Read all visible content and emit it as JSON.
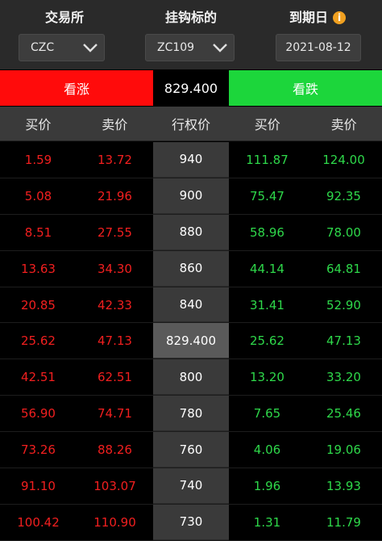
{
  "filters": {
    "exchange": {
      "title": "交易所",
      "value": "CZC"
    },
    "underlying": {
      "title": "挂钩标的",
      "value": "ZC109"
    },
    "expiry": {
      "title": "到期日",
      "value": "2021-08-12",
      "info_icon": "i"
    }
  },
  "strip": {
    "rise_label": "看涨",
    "current_price": "829.400",
    "fall_label": "看跌",
    "colors": {
      "rise": "#ff0b0b",
      "fall": "#1cd63b"
    }
  },
  "table": {
    "headers": [
      "买价",
      "卖价",
      "行权价",
      "买价",
      "卖价"
    ],
    "rows": [
      {
        "call_bid": "1.59",
        "call_ask": "13.72",
        "strike": "940",
        "put_bid": "111.87",
        "put_ask": "124.00"
      },
      {
        "call_bid": "5.08",
        "call_ask": "21.96",
        "strike": "900",
        "put_bid": "75.47",
        "put_ask": "92.35"
      },
      {
        "call_bid": "8.51",
        "call_ask": "27.55",
        "strike": "880",
        "put_bid": "58.96",
        "put_ask": "78.00"
      },
      {
        "call_bid": "13.63",
        "call_ask": "34.30",
        "strike": "860",
        "put_bid": "44.14",
        "put_ask": "64.81"
      },
      {
        "call_bid": "20.85",
        "call_ask": "42.33",
        "strike": "840",
        "put_bid": "31.41",
        "put_ask": "52.90"
      },
      {
        "call_bid": "25.62",
        "call_ask": "47.13",
        "strike": "829.400",
        "put_bid": "25.62",
        "put_ask": "47.13",
        "atm": true
      },
      {
        "call_bid": "42.51",
        "call_ask": "62.51",
        "strike": "800",
        "put_bid": "13.20",
        "put_ask": "33.20"
      },
      {
        "call_bid": "56.90",
        "call_ask": "74.71",
        "strike": "780",
        "put_bid": "7.65",
        "put_ask": "25.46"
      },
      {
        "call_bid": "73.26",
        "call_ask": "88.26",
        "strike": "760",
        "put_bid": "4.06",
        "put_ask": "19.06"
      },
      {
        "call_bid": "91.10",
        "call_ask": "103.07",
        "strike": "740",
        "put_bid": "1.96",
        "put_ask": "13.93"
      },
      {
        "call_bid": "100.42",
        "call_ask": "110.90",
        "strike": "730",
        "put_bid": "1.31",
        "put_ask": "11.79"
      }
    ]
  }
}
